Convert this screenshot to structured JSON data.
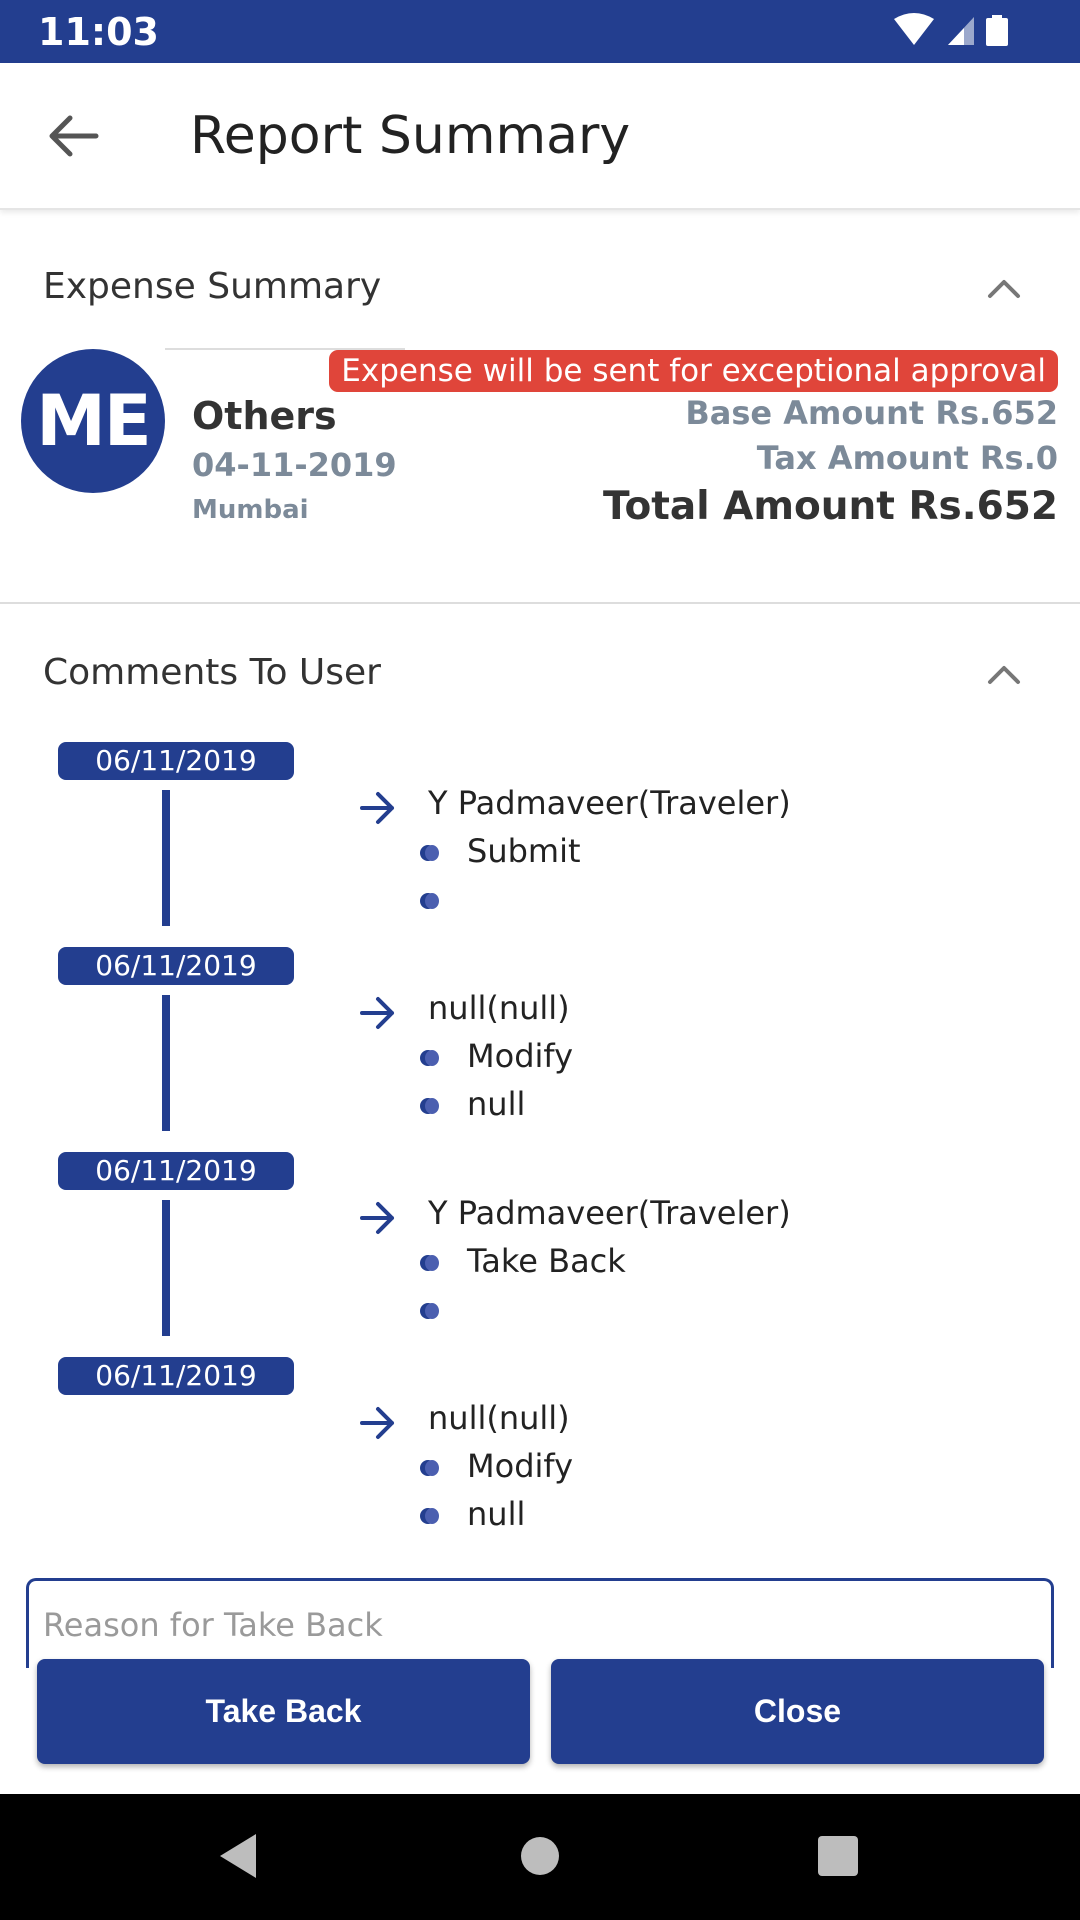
{
  "status_bar": {
    "time": "11:03"
  },
  "app_bar": {
    "title": "Report Summary"
  },
  "expense_summary": {
    "header": "Expense Summary",
    "avatar_initials": "ME",
    "category": "Others",
    "date": "04-11-2019",
    "city": "Mumbai",
    "exception_note": "Expense will be sent for exceptional approval",
    "base_amount": "Base Amount Rs.652",
    "tax_amount": "Tax Amount Rs.0",
    "total_amount": "Total Amount Rs.652"
  },
  "comments": {
    "header": "Comments To User",
    "entries": [
      {
        "date": "06/11/2019",
        "user": "Y Padmaveer(Traveler)",
        "action": "Submit",
        "comment": ""
      },
      {
        "date": "06/11/2019",
        "user": "null(null)",
        "action": "Modify",
        "comment": "null"
      },
      {
        "date": "06/11/2019",
        "user": "Y Padmaveer(Traveler)",
        "action": "Take Back",
        "comment": ""
      },
      {
        "date": "06/11/2019",
        "user": "null(null)",
        "action": "Modify",
        "comment": "null"
      }
    ]
  },
  "reason_input": {
    "placeholder": "Reason for Take Back",
    "value": ""
  },
  "buttons": {
    "take_back": "Take Back",
    "close": "Close"
  },
  "colors": {
    "primary": "#233e8f",
    "badge": "#e0453a",
    "muted_text": "#7c8a99"
  },
  "icons": {
    "back": "arrow-left-icon",
    "collapse": "chevron-up-icon",
    "entry_arrow": "arrow-right-icon",
    "bullet": "bullet-icon",
    "wifi": "wifi-icon",
    "signal": "signal-icon",
    "battery": "battery-icon",
    "nav_back": "triangle-back-icon",
    "nav_home": "circle-home-icon",
    "nav_recents": "square-recents-icon"
  }
}
